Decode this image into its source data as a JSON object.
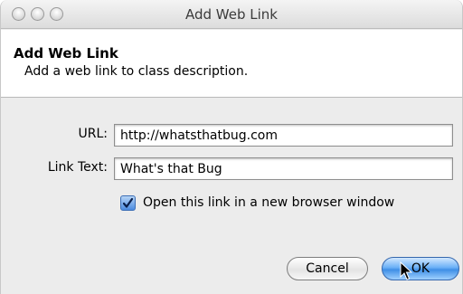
{
  "window": {
    "title": "Add Web Link"
  },
  "header": {
    "title": "Add Web Link",
    "subtitle": "Add a web link to class description."
  },
  "form": {
    "url_label": "URL:",
    "url_value": "http://whatsthatbug.com",
    "link_text_label": "Link Text:",
    "link_text_value": "What's that Bug",
    "new_window_checkbox_label": "Open this link in a new browser window",
    "new_window_checked": true
  },
  "buttons": {
    "cancel_label": "Cancel",
    "ok_label": "OK"
  },
  "icons": {
    "close": "close-icon",
    "minimize": "minimize-icon",
    "zoom": "zoom-icon",
    "check": "checkmark-icon",
    "cursor": "mouse-cursor-icon"
  },
  "colors": {
    "accent": "#3f8fe6"
  }
}
